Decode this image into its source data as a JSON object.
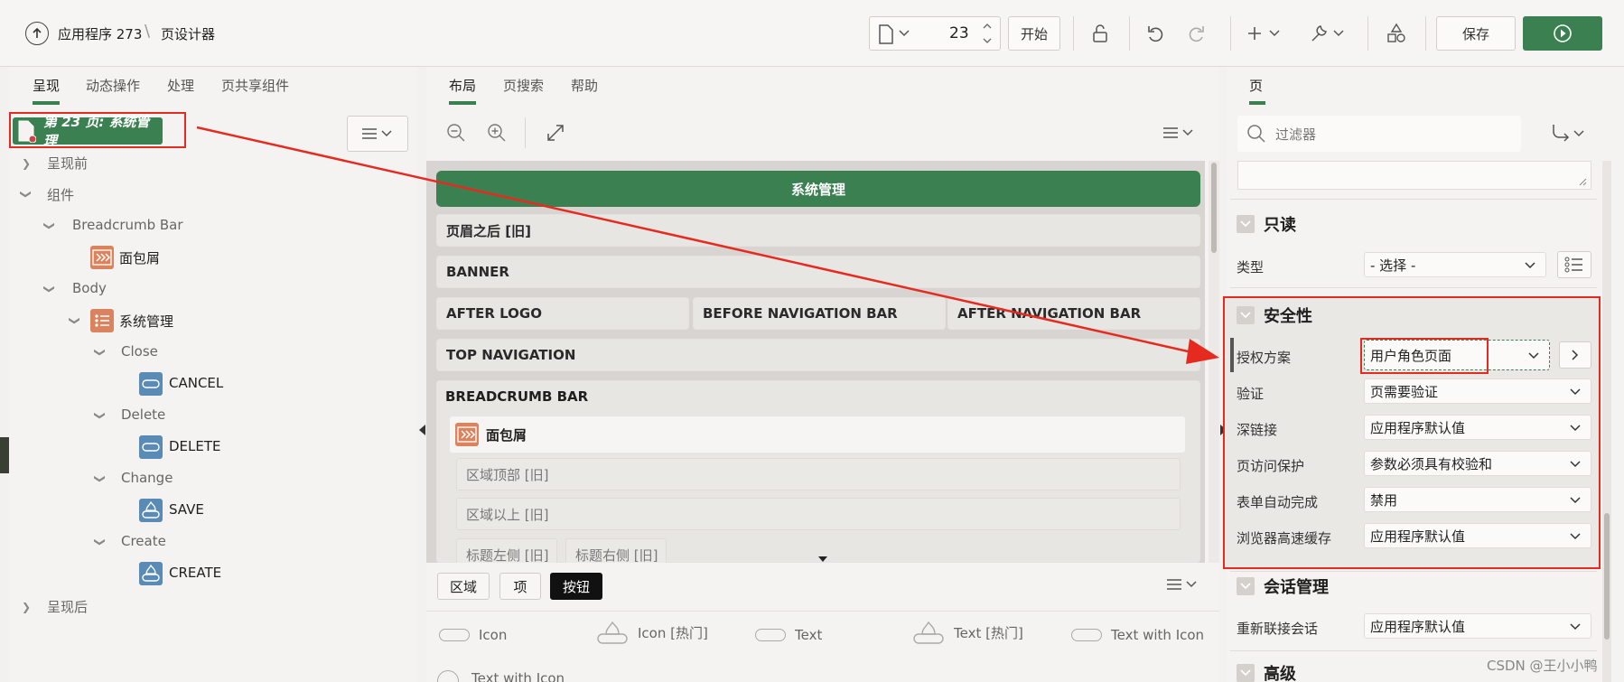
{
  "header": {
    "app_name": "应用程序 273",
    "page_designer": "页设计器",
    "page_number": "23",
    "start_label": "开始",
    "save_label": "保存"
  },
  "left": {
    "tabs": [
      {
        "label": "呈现"
      },
      {
        "label": "动态操作"
      },
      {
        "label": "处理"
      },
      {
        "label": "页共享组件"
      }
    ],
    "page_badge": "第 23 页: 系统管理",
    "tree": {
      "before": "呈现前",
      "components": "组件",
      "breadcrumb_bar": "Breadcrumb Bar",
      "breadcrumb": "面包屑",
      "body": "Body",
      "sys_region": "系统管理",
      "close": "Close",
      "cancel": "CANCEL",
      "delete": "Delete",
      "delete_btn": "DELETE",
      "change": "Change",
      "save_btn": "SAVE",
      "create": "Create",
      "create_btn": "CREATE",
      "after": "呈现后"
    }
  },
  "middle": {
    "tabs": [
      {
        "label": "布局"
      },
      {
        "label": "页搜索"
      },
      {
        "label": "帮助"
      }
    ],
    "title_bar": "系统管理",
    "regions": {
      "after_header": "页眉之后 [旧]",
      "banner": "BANNER",
      "after_logo": "AFTER LOGO",
      "before_nav": "BEFORE NAVIGATION BAR",
      "after_nav": "AFTER NAVIGATION BAR",
      "top_nav": "TOP NAVIGATION",
      "breadcrumb_bar": "BREADCRUMB BAR",
      "breadcrumb": "面包屑",
      "region_top": "区域顶部 [旧]",
      "region_above": "区域以上 [旧]",
      "title_left": "标题左侧 [旧]",
      "title_right": "标题右侧 [旧]"
    },
    "gallery_tabs": [
      {
        "label": "区域"
      },
      {
        "label": "项"
      },
      {
        "label": "按钮"
      }
    ],
    "gallery": {
      "icon": "Icon",
      "icon_hot": "Icon [热门]",
      "text": "Text",
      "text_hot": "Text [热门]",
      "text_with_icon": "Text with Icon",
      "text_with_icon2": "Text with Icon"
    }
  },
  "right": {
    "tab": "页",
    "filter_placeholder": "过滤器",
    "readonly": {
      "title": "只读",
      "type_label": "类型",
      "type_value": "- 选择 -"
    },
    "security": {
      "title": "安全性",
      "auth_scheme_label": "授权方案",
      "auth_scheme_value": "用户角色页面",
      "auth_label": "验证",
      "auth_value": "页需要验证",
      "deep_link_label": "深链接",
      "deep_link_value": "应用程序默认值",
      "page_access_label": "页访问保护",
      "page_access_value": "参数必须具有校验和",
      "form_auto_label": "表单自动完成",
      "form_auto_value": "禁用",
      "browser_cache_label": "浏览器高速缓存",
      "browser_cache_value": "应用程序默认值"
    },
    "session": {
      "title": "会话管理",
      "rejoin_label": "重新联接会话",
      "rejoin_value": "应用程序默认值"
    },
    "advanced": {
      "title": "高级"
    }
  },
  "watermark": "CSDN @王小小鸭",
  "colors": {
    "accent_green": "#3b8050",
    "annotation_red": "#e52b20"
  }
}
